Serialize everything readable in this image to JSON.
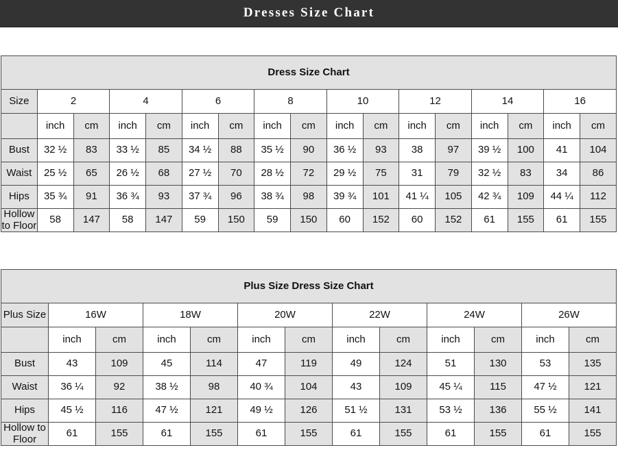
{
  "banner": {
    "title": "Dresses Size Chart"
  },
  "tables": [
    {
      "caption": "Dress Size Chart",
      "size_label": "Size",
      "unit_inch": "inch",
      "unit_cm": "cm",
      "sizes": [
        "2",
        "4",
        "6",
        "8",
        "10",
        "12",
        "14",
        "16"
      ],
      "rows": [
        {
          "label": "Bust",
          "inch": [
            "32 ½",
            "33 ½",
            "34 ½",
            "35 ½",
            "36 ½",
            "38",
            "39 ½",
            "41"
          ],
          "cm": [
            "83",
            "85",
            "88",
            "90",
            "93",
            "97",
            "100",
            "104"
          ]
        },
        {
          "label": "Waist",
          "inch": [
            "25 ½",
            "26 ½",
            "27 ½",
            "28 ½",
            "29 ½",
            "31",
            "32 ½",
            "34"
          ],
          "cm": [
            "65",
            "68",
            "70",
            "72",
            "75",
            "79",
            "83",
            "86"
          ]
        },
        {
          "label": "Hips",
          "inch": [
            "35 ¾",
            "36 ¾",
            "37 ¾",
            "38 ¾",
            "39 ¾",
            "41 ¼",
            "42 ¾",
            "44 ¼"
          ],
          "cm": [
            "91",
            "93",
            "96",
            "98",
            "101",
            "105",
            "109",
            "112"
          ]
        },
        {
          "label": "Hollow to Floor",
          "inch": [
            "58",
            "58",
            "59",
            "59",
            "60",
            "60",
            "61",
            "61"
          ],
          "cm": [
            "147",
            "147",
            "150",
            "150",
            "152",
            "152",
            "155",
            "155"
          ]
        }
      ]
    },
    {
      "caption": "Plus Size Dress Size Chart",
      "size_label": "Plus Size",
      "unit_inch": "inch",
      "unit_cm": "cm",
      "sizes": [
        "16W",
        "18W",
        "20W",
        "22W",
        "24W",
        "26W"
      ],
      "rows": [
        {
          "label": "Bust",
          "inch": [
            "43",
            "45",
            "47",
            "49",
            "51",
            "53"
          ],
          "cm": [
            "109",
            "114",
            "119",
            "124",
            "130",
            "135"
          ]
        },
        {
          "label": "Waist",
          "inch": [
            "36 ¼",
            "38 ½",
            "40 ¾",
            "43",
            "45 ¼",
            "47 ½"
          ],
          "cm": [
            "92",
            "98",
            "104",
            "109",
            "115",
            "121"
          ]
        },
        {
          "label": "Hips",
          "inch": [
            "45 ½",
            "47 ½",
            "49 ½",
            "51 ½",
            "53 ½",
            "55 ½"
          ],
          "cm": [
            "116",
            "121",
            "126",
            "131",
            "136",
            "141"
          ]
        },
        {
          "label": "Hollow to Floor",
          "inch": [
            "61",
            "61",
            "61",
            "61",
            "61",
            "61"
          ],
          "cm": [
            "155",
            "155",
            "155",
            "155",
            "155",
            "155"
          ]
        }
      ]
    }
  ],
  "colors": {
    "banner_bg": "#333333",
    "banner_text": "#ffffff",
    "cell_shade": "#e2e2e2",
    "cell_plain": "#ffffff",
    "border": "#4a4a4a"
  }
}
